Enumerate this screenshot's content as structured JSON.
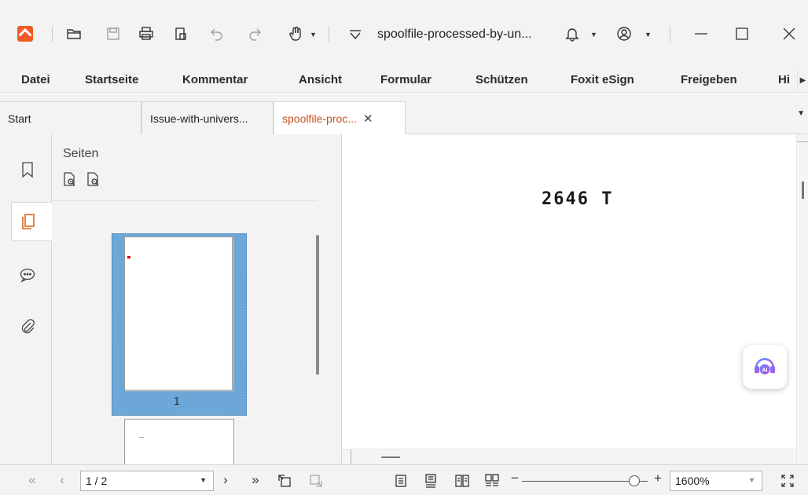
{
  "app": {
    "document_title": "spoolfile-processed-by-un...",
    "brand_color": "#f15a24",
    "accent_tab_color": "#c8501e"
  },
  "menu": {
    "items": [
      "Datei",
      "Startseite",
      "Kommentar",
      "Ansicht",
      "Formular",
      "Schützen",
      "Foxit eSign",
      "Freigeben",
      "Hi"
    ]
  },
  "tabs": [
    {
      "label": "Start"
    },
    {
      "label": "Issue-with-univers..."
    },
    {
      "label": "spoolfile-proc...",
      "active": true
    }
  ],
  "panel": {
    "title": "Seiten",
    "thumbnail_page_number": "1"
  },
  "document": {
    "visible_text": "2646 T"
  },
  "ai_button": {
    "icon": "ai-assistant-headset-icon"
  },
  "statusbar": {
    "page_field": "1 / 2",
    "zoom_value": "1600%",
    "zoom_minus": "−",
    "zoom_plus": "+"
  }
}
